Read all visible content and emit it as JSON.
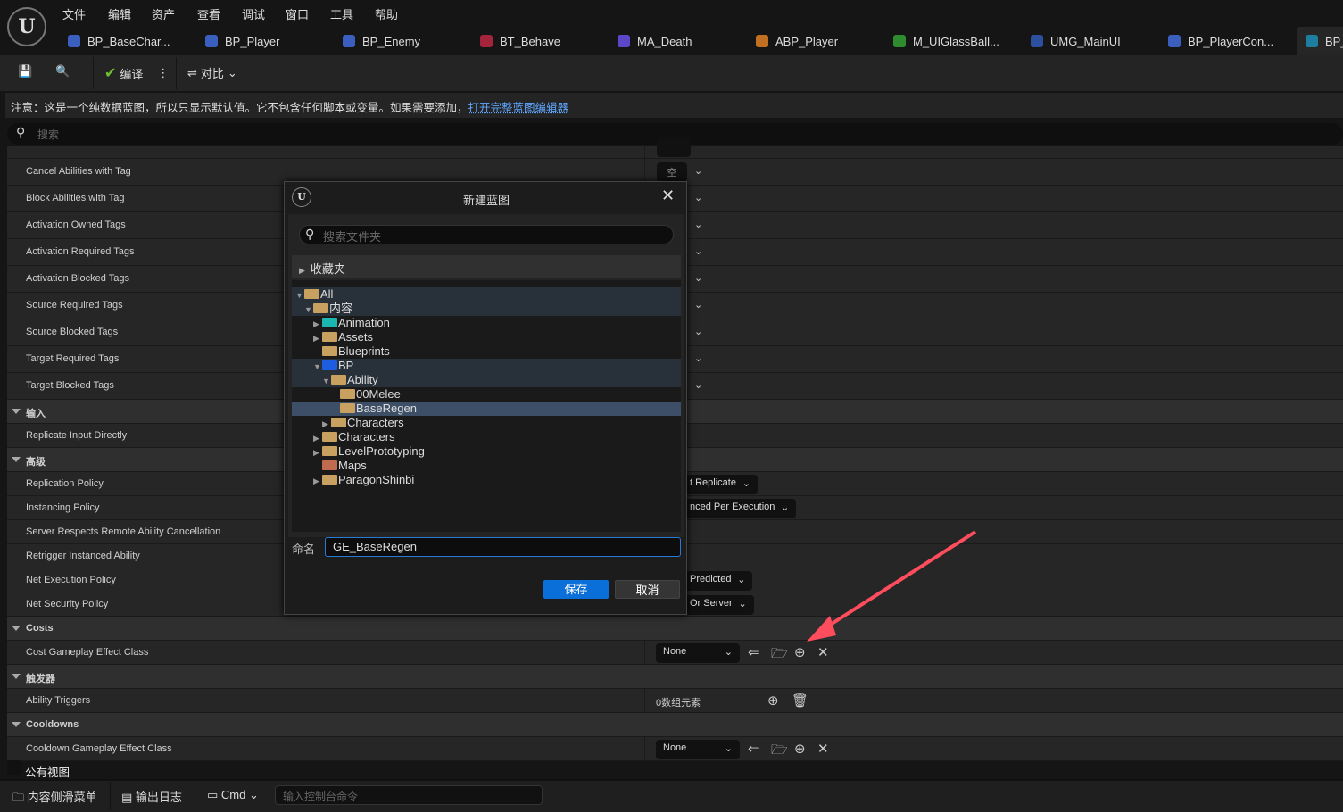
{
  "menu": [
    "文件",
    "编辑",
    "资产",
    "查看",
    "调试",
    "窗口",
    "工具",
    "帮助"
  ],
  "tabs": [
    {
      "label": "BP_BaseChar...",
      "icon": "character-blueprint-icon",
      "color": "#3b5fbf"
    },
    {
      "label": "BP_Player",
      "icon": "character-blueprint-icon",
      "color": "#3b5fbf"
    },
    {
      "label": "BP_Enemy",
      "icon": "character-blueprint-icon",
      "color": "#3b5fbf"
    },
    {
      "label": "BT_Behave",
      "icon": "behavior-tree-icon",
      "color": "#a3243b"
    },
    {
      "label": "MA_Death",
      "icon": "montage-icon",
      "color": "#5a48c8"
    },
    {
      "label": "ABP_Player",
      "icon": "anim-blueprint-icon",
      "color": "#c07020"
    },
    {
      "label": "M_UIGlassBall...",
      "icon": "material-icon",
      "color": "#2e8b2e"
    },
    {
      "label": "UMG_MainUI",
      "icon": "widget-blueprint-icon",
      "color": "#2d4fa0"
    },
    {
      "label": "BP_PlayerCon...",
      "icon": "controller-icon",
      "color": "#3b5fbf"
    },
    {
      "label": "BP_",
      "icon": "data-blueprint-icon",
      "color": "#1e7ea0"
    }
  ],
  "toolbar": {
    "compile": "编译",
    "diff": "对比"
  },
  "notice": {
    "text": "注意：这是一个纯数据蓝图，所以只显示默认值。它不包含任何脚本或变量。如果需要添加，",
    "link": "打开完整蓝图编辑器"
  },
  "search_placeholder": "搜索",
  "properties": [
    {
      "label": "Cancel Abilities with Tag",
      "value": "空",
      "chevron": true
    },
    {
      "label": "Block Abilities with Tag",
      "chevron": true
    },
    {
      "label": "Activation Owned Tags",
      "chevron": true
    },
    {
      "label": "Activation Required Tags",
      "chevron": true
    },
    {
      "label": "Activation Blocked Tags",
      "chevron": true
    },
    {
      "label": "Source Required Tags",
      "chevron": true
    },
    {
      "label": "Source Blocked Tags",
      "chevron": true
    },
    {
      "label": "Target Required Tags",
      "chevron": true
    },
    {
      "label": "Target Blocked Tags",
      "chevron": true
    },
    {
      "label": "输入",
      "category": true
    },
    {
      "label": "Replicate Input Directly"
    },
    {
      "label": "高级",
      "category": true
    },
    {
      "label": "Replication Policy",
      "dropdown": "t Replicate"
    },
    {
      "label": "Instancing Policy",
      "dropdown": "nced Per Execution"
    },
    {
      "label": "Server Respects Remote Ability Cancellation"
    },
    {
      "label": "Retrigger Instanced Ability"
    },
    {
      "label": "Net Execution Policy",
      "dropdown": "Predicted"
    },
    {
      "label": "Net Security Policy",
      "dropdown": "Or Server"
    },
    {
      "label": "Costs",
      "category": true
    },
    {
      "label": "Cost Gameplay Effect Class",
      "class_value": "None"
    },
    {
      "label": "触发器",
      "category": true
    },
    {
      "label": "Ability Triggers",
      "array_value": "0数组元素"
    },
    {
      "label": "Cooldowns",
      "category": true
    },
    {
      "label": "Cooldown Gameplay Effect Class",
      "class_value": "None"
    }
  ],
  "public_view": "公有视图",
  "dialog": {
    "title": "新建蓝图",
    "search_placeholder": "搜索文件夹",
    "favorites": "收藏夹",
    "tree": [
      {
        "label": "All",
        "depth": 0,
        "expanded": true,
        "color": "#c8a060",
        "hl": true
      },
      {
        "label": "内容",
        "depth": 1,
        "expanded": true,
        "color": "#c8a060",
        "hl": true
      },
      {
        "label": "Animation",
        "depth": 2,
        "collapsed": true,
        "color": "#1ab8b0"
      },
      {
        "label": "Assets",
        "depth": 2,
        "collapsed": true,
        "color": "#c8a060"
      },
      {
        "label": "Blueprints",
        "depth": 2,
        "color": "#c8a060"
      },
      {
        "label": "BP",
        "depth": 2,
        "expanded": true,
        "color": "#1f5de0",
        "hl": true
      },
      {
        "label": "Ability",
        "depth": 3,
        "expanded": true,
        "color": "#c8a060",
        "hl": true
      },
      {
        "label": "00Melee",
        "depth": 4,
        "color": "#c8a060"
      },
      {
        "label": "BaseRegen",
        "depth": 4,
        "color": "#c8a060",
        "selected": true
      },
      {
        "label": "Characters",
        "depth": 3,
        "collapsed": true,
        "color": "#c8a060"
      },
      {
        "label": "Characters",
        "depth": 2,
        "collapsed": true,
        "color": "#c8a060"
      },
      {
        "label": "LevelPrototyping",
        "depth": 2,
        "collapsed": true,
        "color": "#c8a060"
      },
      {
        "label": "Maps",
        "depth": 2,
        "color": "#c06a50"
      },
      {
        "label": "ParagonShinbi",
        "depth": 2,
        "collapsed": true,
        "color": "#c8a060"
      }
    ],
    "name_label": "命名",
    "name_value": "GE_BaseRegen",
    "save": "保存",
    "cancel": "取消",
    "save_color": "#0a6fd8"
  },
  "bottom": {
    "content_drawer": "内容侧滑菜单",
    "output_log": "输出日志",
    "cmd": "Cmd",
    "console_placeholder": "输入控制台命令"
  },
  "annotation_color": "#ff4d5e"
}
